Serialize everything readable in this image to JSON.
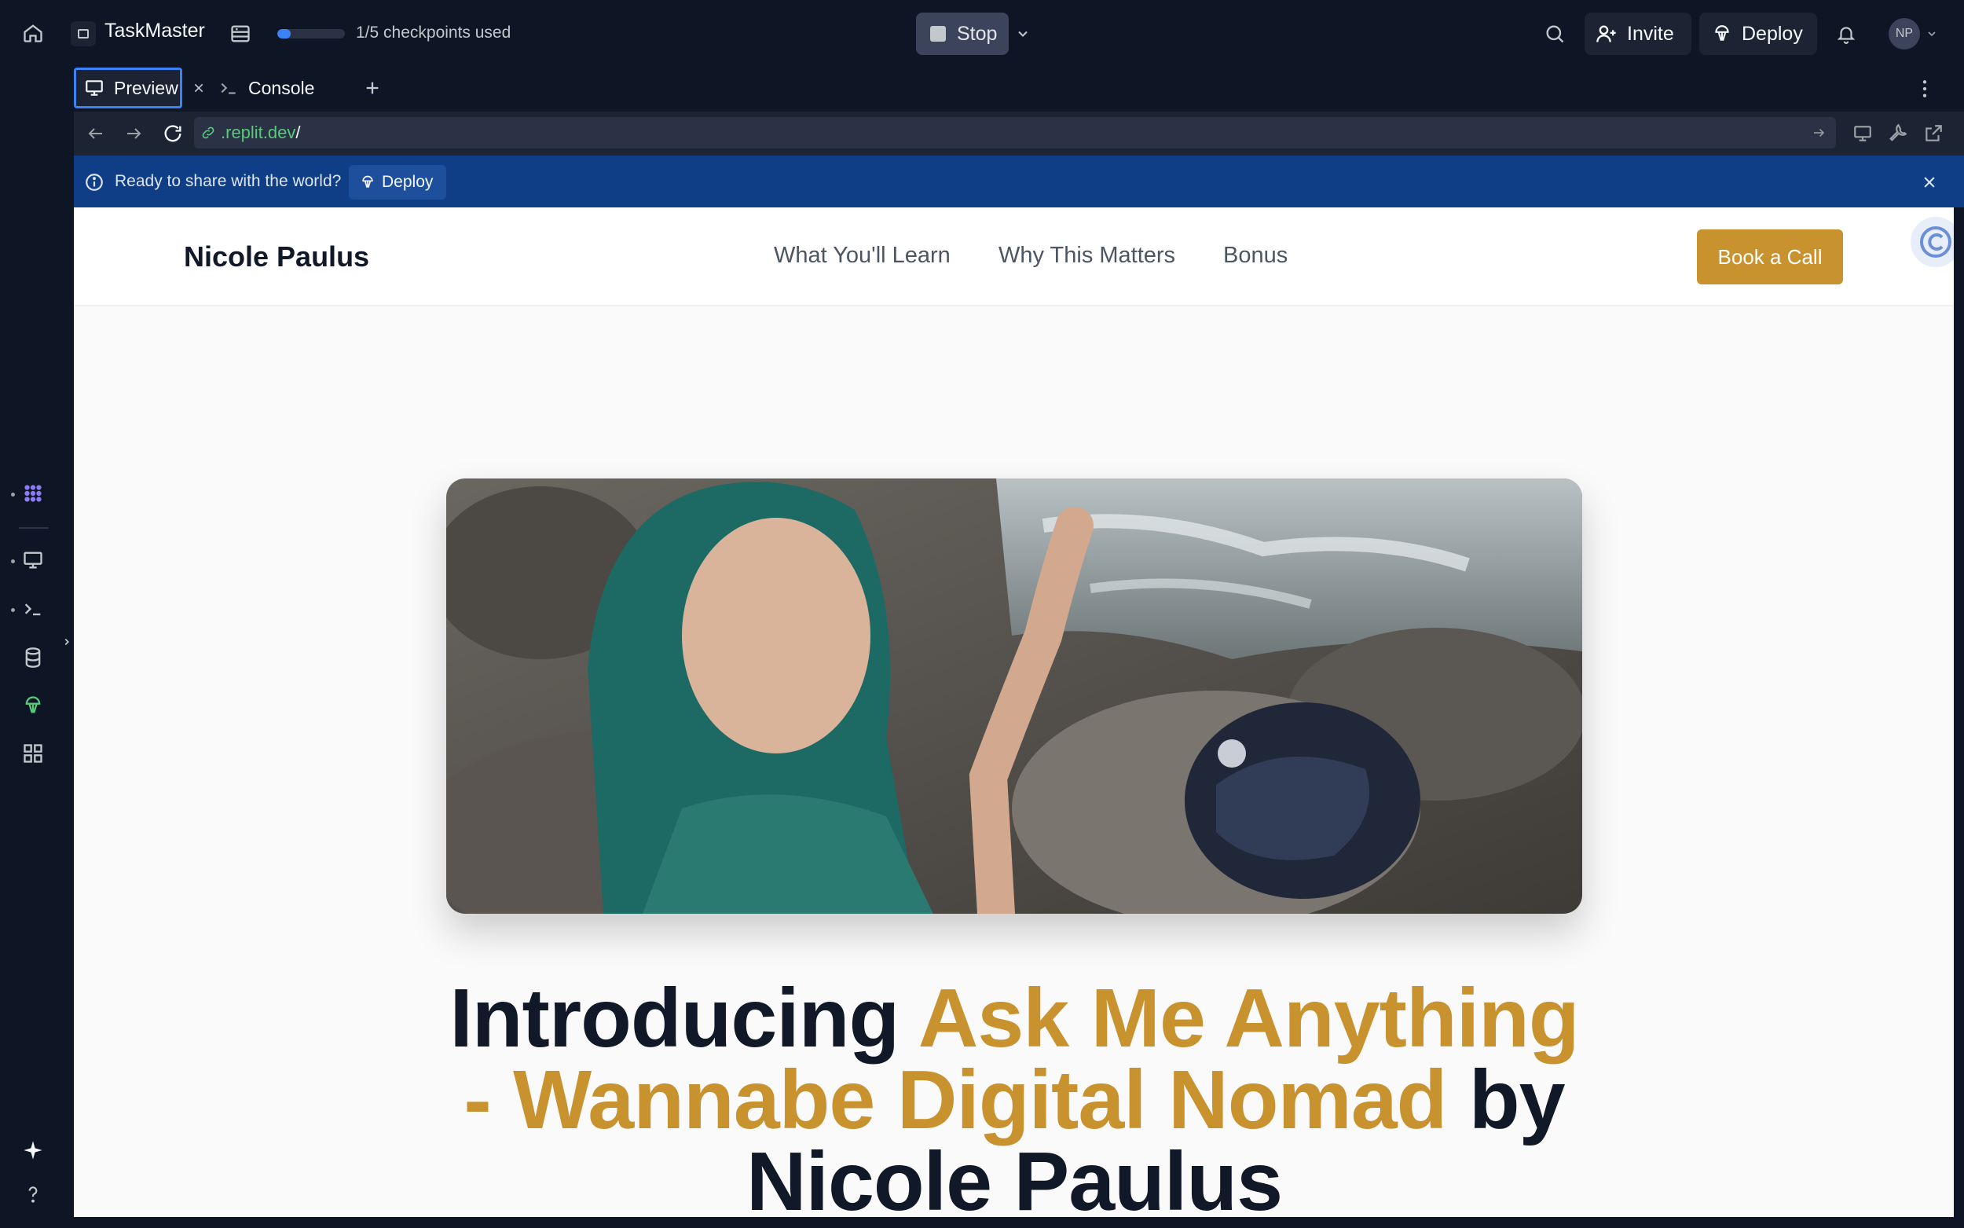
{
  "topbar": {
    "app_name": "TaskMaster",
    "checkpoints_text": "1/5 checkpoints used",
    "checkpoints_progress": 0.2,
    "stop_label": "Stop",
    "invite_label": "Invite",
    "deploy_label": "Deploy",
    "avatar_initials": "NP"
  },
  "tabs": [
    {
      "label": "Preview"
    },
    {
      "label": "Console"
    }
  ],
  "urlbar": {
    "domain": ".replit.dev",
    "path": "/"
  },
  "banner": {
    "text": "Ready to share with the world?",
    "deploy_label": "Deploy"
  },
  "site": {
    "brand": "Nicole Paulus",
    "nav": [
      "What You'll Learn",
      "Why This Matters",
      "Bonus"
    ],
    "cta_label": "Book a Call",
    "hero_title_part1": "Introducing ",
    "hero_title_highlight": "Ask Me Anything - Wannabe Digital Nomad",
    "hero_title_part2": " by Nicole Paulus"
  },
  "colors": {
    "background": "#0e1525",
    "accent_blue": "#3b82f6",
    "banner_blue": "#0f3d86",
    "gold": "#c8922f",
    "url_green": "#58c97a"
  },
  "icons": [
    "home-icon",
    "database-icon",
    "stop-icon",
    "search-icon",
    "add-user-icon",
    "deploy-icon",
    "bell-icon",
    "file-tree-icon",
    "agent-icon",
    "monitor-icon",
    "terminal-icon",
    "database-rail-icon",
    "deploy-rail-icon",
    "apps-grid-icon",
    "sparkle-icon",
    "help-icon",
    "info-icon",
    "close-icon",
    "link-icon"
  ]
}
